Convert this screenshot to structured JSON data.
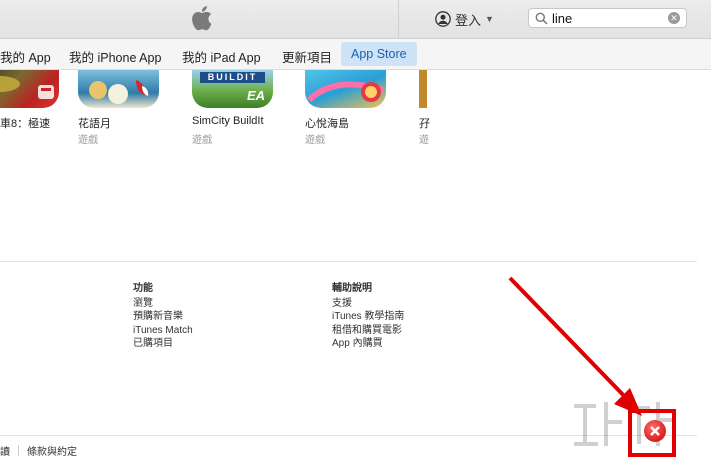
{
  "titlebar": {
    "signin_label": "登入",
    "search": {
      "value": "line"
    }
  },
  "nav": {
    "tabs": [
      "我的 App",
      "我的 iPhone App",
      "我的 iPad App",
      "更新項目",
      "App Store"
    ],
    "active_tab": "App Store"
  },
  "apps": [
    {
      "name": "車8：極速",
      "category": ""
    },
    {
      "name": "花語月",
      "category": "遊戲"
    },
    {
      "name": "SimCity BuildIt",
      "category": "遊戲",
      "banner": "BUILDIT",
      "badge": "EA"
    },
    {
      "name": "心悅海島",
      "category": "遊戲"
    },
    {
      "name": "孖",
      "category": "遊"
    }
  ],
  "footer": {
    "features": {
      "heading": "功能",
      "links": [
        "瀏覽",
        "預購新音樂",
        "iTunes Match",
        "已購項目"
      ]
    },
    "help": {
      "heading": "輔助說明",
      "links": [
        "支援",
        "iTunes 教學指南",
        "租借和購買電影",
        "App 內購買"
      ]
    },
    "bottom_links": [
      "讀",
      "條款與約定"
    ]
  },
  "colors": {
    "active_tab_bg": "#cfe3f7",
    "active_tab_text": "#1a5fb4",
    "annotation_red": "#e00000"
  }
}
